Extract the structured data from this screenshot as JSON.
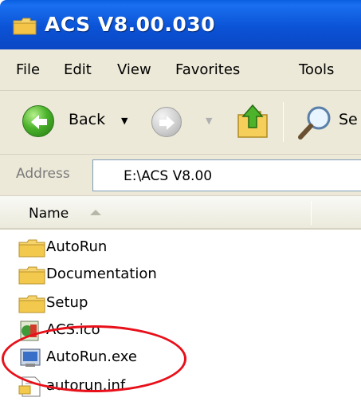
{
  "window": {
    "title": "ACS V8.00.030",
    "icon": "folder-icon"
  },
  "menu": {
    "items": [
      "File",
      "Edit",
      "View",
      "Favorites",
      "Tools"
    ]
  },
  "toolbar": {
    "back_label": "Back",
    "search_label": "Se",
    "icons": [
      "back-arrow-icon",
      "forward-arrow-icon",
      "folder-up-icon",
      "search-icon"
    ]
  },
  "address": {
    "label": "Address",
    "value": "E:\\ACS V8.00"
  },
  "list": {
    "column_name": "Name",
    "sort": "ascending",
    "items": [
      {
        "name": "AutoRun",
        "icon": "folder-icon"
      },
      {
        "name": "Documentation",
        "icon": "folder-icon"
      },
      {
        "name": "Setup",
        "icon": "folder-icon"
      },
      {
        "name": "ACS.ico",
        "icon": "ico-file-icon"
      },
      {
        "name": "AutoRun.exe",
        "icon": "exe-file-icon"
      },
      {
        "name": "autorun.inf",
        "icon": "inf-file-icon"
      }
    ]
  },
  "annotation": {
    "color": "#e8101a",
    "target": "AutoRun.exe"
  },
  "colors": {
    "titlebar": "#0b53d6",
    "chrome": "#ece9d8",
    "folder": "#f2c94c"
  }
}
